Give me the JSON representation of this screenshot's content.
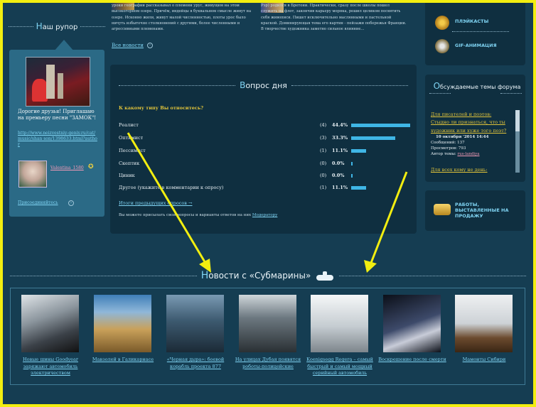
{
  "left": {
    "rupor_first": "Н",
    "rupor_rest": "аш рупор",
    "greeting": "Дорогие друзья! Приглашаю на премьеру песни \"ЗАМОК\"!",
    "greeting_link": "http://www.neizvestniy-geniy.ru/cat/music/shan son/1398633.html?author",
    "author": "Valentina_1580",
    "join": "Присоединяйтесь"
  },
  "snippets": {
    "col1": "уроки географии рассказывал о племени урус, живущем на этом высокогорном озере. Причём, индейцы в буквальном смысле живут на озере. Исконно жили, живут малой численностью, плоты урос было ничуть избыточно столкновений с другими, более численными и агрессивными племенами.",
    "col2": "Рэр) родился в Бретони. Практически, сразу после школы пошел служить на флот, закончив карьеру моряка, решил целиком посвятить себя живописи. Пишет исключительно маслянными и пастельной краской. Доминирующая тема его картин - пейзажи побережья Франции. В творчестве художника заметно сильное влияние...",
    "all_news": "Все новости"
  },
  "poll": {
    "title_first": "В",
    "title_rest": "опрос дня",
    "question": "К какому типу Вы относитесь?",
    "options": [
      {
        "label": "Реалист",
        "count": "(4)",
        "pct": "44.4%",
        "fraction": 0.444
      },
      {
        "label": "Оптимист",
        "count": "(3)",
        "pct": "33.3%",
        "fraction": 0.333
      },
      {
        "label": "Пессимист",
        "count": "(1)",
        "pct": "11.1%",
        "fraction": 0.111
      },
      {
        "label": "Скептик",
        "count": "(0)",
        "pct": "0.0%",
        "fraction": 0
      },
      {
        "label": "Циник",
        "count": "(0)",
        "pct": "0.0%",
        "fraction": 0
      },
      {
        "label": "Другое (укажите в комментарии к опросу)",
        "count": "(1)",
        "pct": "11.1%",
        "fraction": 0.111
      }
    ],
    "results_link": "Итоги предыдущих опросов →",
    "note": "Вы можете присылать свои вопросы и варианты ответов на них",
    "moderator": "Модератору"
  },
  "right": {
    "playcasts": "ПЛЭЙКАСТЫ",
    "gif": "GIF-АНИМАЦИЯ",
    "forum_title": "Обсуждаемые темы форума",
    "forum_first": "О",
    "forum_rest": "бсуждаемые темы форума",
    "forum_link1": "Для писателей и поэтов:",
    "forum_link2": "Стыдно ли признаться, что ты художник или хуже того поэт?",
    "forum_date": "10 октября '2014      14:44",
    "forum_messages": "Сообщений: 137",
    "forum_views": "Просмотров: 793",
    "forum_author_label": "Автор темы:",
    "forum_author": "rus-landiya",
    "forum_link3": "Для всех кому не день:",
    "works": "РАБОТЫ, ВЫСТАВЛЕННЫЕ НА ПРОДАЖУ"
  },
  "submarine": {
    "title_first": "Н",
    "title_rest": "овости с «Субмарины»",
    "news": [
      {
        "caption": "Новые шины Goodyear заряжают автомобиль электричеством"
      },
      {
        "caption": "Мавзолей в Галикарнасе"
      },
      {
        "caption": "«Черная дыра»: боевой корабль проекта 877"
      },
      {
        "caption": "На улицах Дубая появятся роботы-полицейские"
      },
      {
        "caption": "Koenigsegg Regera – самый быстрый и самый мощный серийный автомобиль"
      },
      {
        "caption": "Воскрешение после смерти"
      },
      {
        "caption": "Мамонты Сибири"
      }
    ]
  },
  "colors": {
    "background": "#153d52",
    "panel": "#0f2f40",
    "accent_link": "#7fd3f2",
    "highlight": "#e0c33a",
    "frame": "#f2ee10",
    "bar": "#3fb6e6"
  }
}
